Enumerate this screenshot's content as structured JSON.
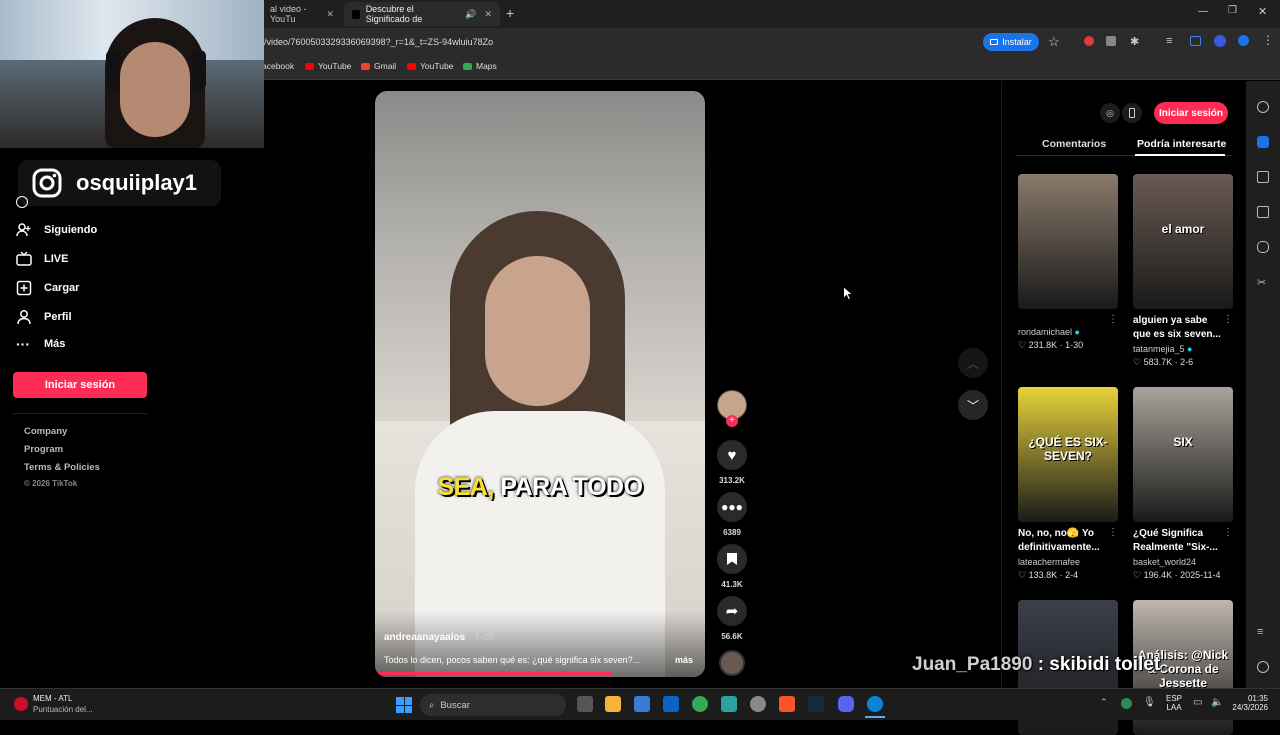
{
  "browser": {
    "tabs": [
      {
        "label": "al video - YouTu",
        "active": false
      },
      {
        "label": "Descubre el Significado de",
        "active": true
      }
    ],
    "url": "/video/7600503329336069398?_r=1&_t=ZS-94wluiu78Zo",
    "install_label": "Instalar",
    "bookmarks": [
      "acebook",
      "YouTube",
      "Gmail",
      "YouTube",
      "Maps"
    ]
  },
  "overlay": {
    "instagram_handle": "osquiiplay1",
    "chat_user": "Juan_Pa1890",
    "chat_message": ": skibidi toilet"
  },
  "sidebar": {
    "items": [
      {
        "label": "Siguiendo",
        "icon": "following-icon"
      },
      {
        "label": "LIVE",
        "icon": "live-icon"
      },
      {
        "label": "Cargar",
        "icon": "upload-icon"
      },
      {
        "label": "Perfil",
        "icon": "profile-icon"
      },
      {
        "label": "Más",
        "icon": "more-icon"
      }
    ],
    "login_label": "Iniciar sesión",
    "footer": [
      "Company",
      "Program",
      "Terms & Policies",
      "© 2026 TikTok"
    ]
  },
  "video": {
    "caption_overlay_1": "SEA,",
    "caption_overlay_2": "PARA TODO",
    "author": "andreaanayaalos",
    "age": "· 1-28",
    "description": "Todos lo dicen, pocos saben qué es: ¿qué significa six seven?...",
    "more_label": "más",
    "likes": "313.2K",
    "comments": "6389",
    "saves": "41.3K",
    "shares": "56.6K"
  },
  "right_panel": {
    "login_label": "Iniciar sesión",
    "tabs": [
      "Comentarios",
      "Podría interesarte"
    ],
    "active_tab": 1,
    "cards": [
      {
        "title": "",
        "author": "rondamichael",
        "verified": true,
        "likes": "231.8K",
        "date": "1-30",
        "thumb_color": "#8a7a6a",
        "thumb_text": ""
      },
      {
        "title": "alguien ya sabe que es six seven...",
        "author": "tatanmejia_5",
        "verified": true,
        "likes": "583.7K",
        "date": "2-6",
        "thumb_color": "#6a5a52",
        "thumb_text": "el amor"
      },
      {
        "title": "No, no, no🫣 Yo definitivamente...",
        "author": "lateachermafee",
        "verified": false,
        "likes": "133.8K",
        "date": "2-4",
        "thumb_color": "#e8d23a",
        "thumb_text": "¿QUÉ ES SIX-SEVEN?"
      },
      {
        "title": "¿Qué Significa Realmente \"Six-...",
        "author": "basket_world24",
        "verified": false,
        "likes": "196.4K",
        "date": "2025-11-4",
        "thumb_color": "#a8a39a",
        "thumb_text": "SIX"
      },
      {
        "title": "",
        "author": "",
        "verified": false,
        "likes": "",
        "date": "",
        "thumb_color": "#3a3f4a",
        "thumb_text": ""
      },
      {
        "title": "",
        "author": "",
        "verified": false,
        "likes": "",
        "date": "",
        "thumb_color": "#bfb7b0",
        "thumb_text": "Análisis: @Nick & Corona de Jessette"
      }
    ]
  },
  "taskbar": {
    "weather_title": "MEM - ATL",
    "weather_sub": "Puntuación del...",
    "search_placeholder": "Buscar",
    "lang_1": "ESP",
    "lang_2": "LAA",
    "time": "01:35",
    "date": "24/3/2026"
  },
  "colors": {
    "accent": "#fe2c55",
    "install_blue": "#1a73e8",
    "caption_yellow": "#f7e233"
  }
}
